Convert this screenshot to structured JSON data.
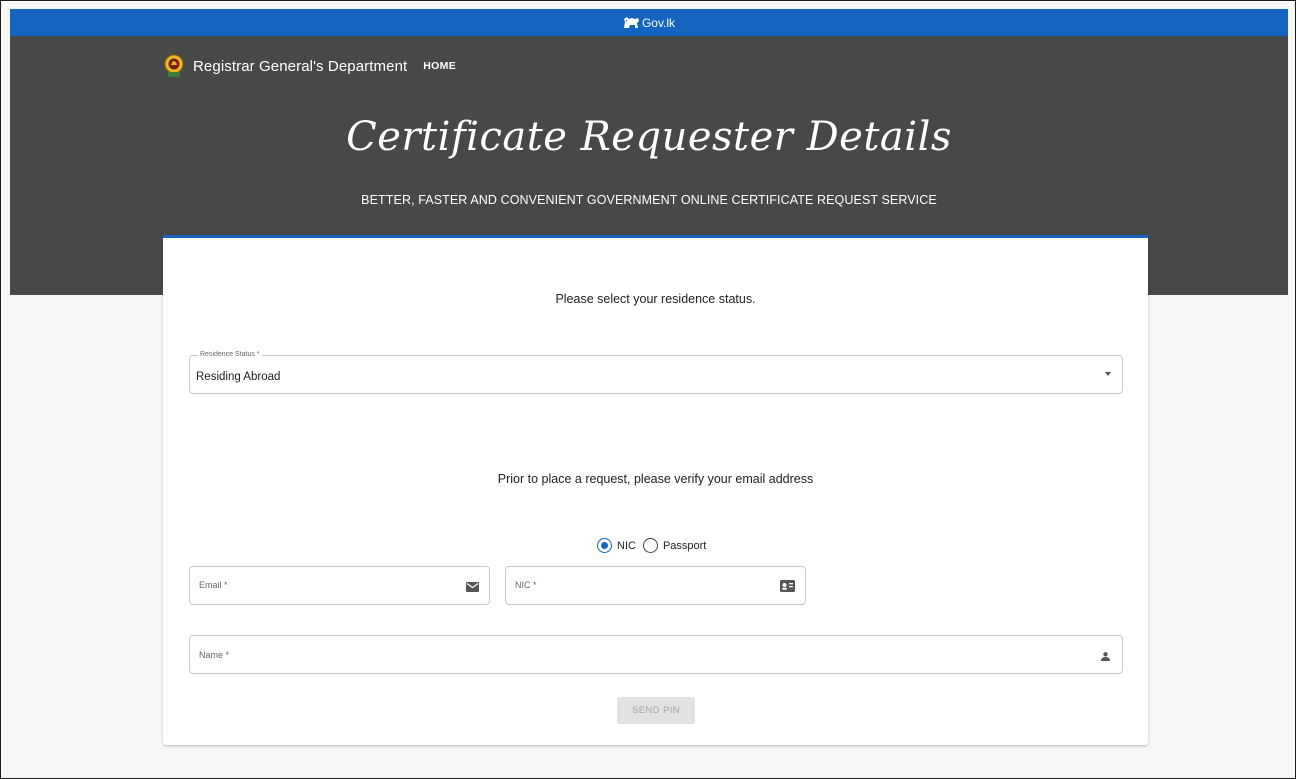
{
  "gov_bar": {
    "logo_text": "Gov.lk"
  },
  "header": {
    "brand_name": "Registrar General's Department",
    "nav_home": "HOME",
    "title": "Certificate Requester Details",
    "subtitle": "BETTER, FASTER AND CONVENIENT GOVERNMENT ONLINE CERTIFICATE REQUEST SERVICE"
  },
  "form": {
    "residence_prompt": "Please select your residence status.",
    "residence_status": {
      "label": "Residence Status *",
      "value": "Residing Abroad"
    },
    "verify_prompt": "Prior to place a request, please verify your email address",
    "id_type": {
      "options": [
        "NIC",
        "Passport"
      ],
      "selected": "NIC"
    },
    "email": {
      "placeholder": "Email *",
      "icon": "envelope-icon"
    },
    "nic": {
      "placeholder": "NIC *",
      "icon": "id-card-icon"
    },
    "name": {
      "placeholder": "Name *",
      "icon": "person-icon"
    },
    "send_pin_label": "SEND PIN"
  },
  "colors": {
    "gov_bar": "#1565c0",
    "hero_bg": "#484848",
    "accent": "#1565c0",
    "disabled_button_bg": "#e2e2e2"
  }
}
